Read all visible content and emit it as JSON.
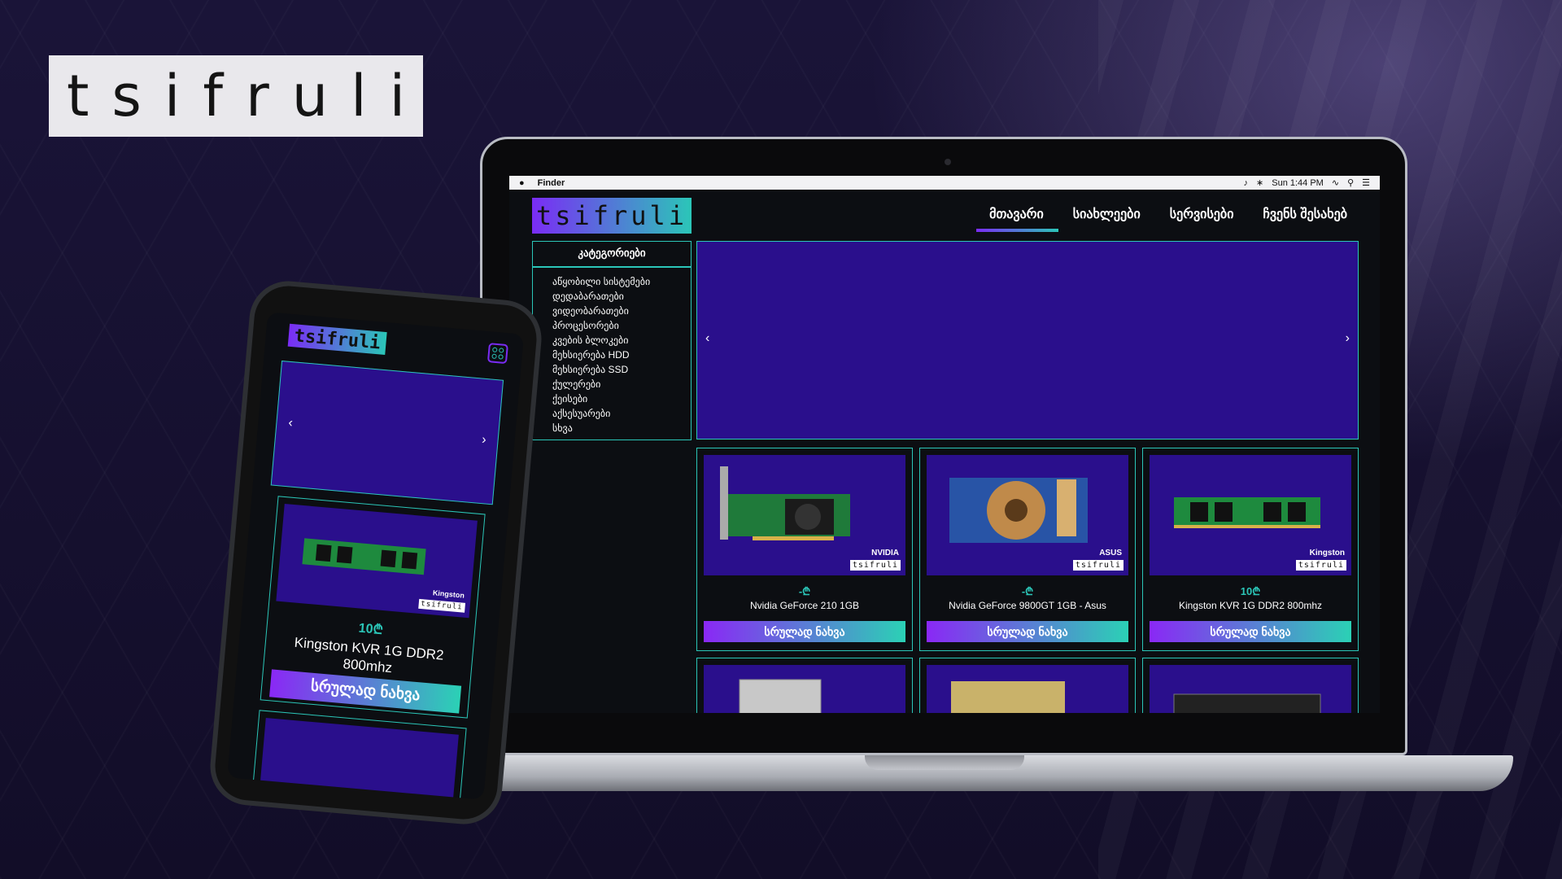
{
  "brand": {
    "text": "tsifruli"
  },
  "macos_menubar": {
    "app": "Finder",
    "clock": "Sun 1:44 PM",
    "icons": [
      "apple-icon",
      "volume-icon",
      "bluetooth-icon",
      "wifi-icon",
      "search-icon",
      "list-icon"
    ]
  },
  "site": {
    "logo": "tsifruli",
    "nav": [
      {
        "label": "მთავარი",
        "active": true
      },
      {
        "label": "სიახლეები",
        "active": false
      },
      {
        "label": "სერვისები",
        "active": false
      },
      {
        "label": "ჩვენს შესახებ",
        "active": false
      }
    ],
    "categories": {
      "title": "კატეგორიები",
      "items": [
        "აწყობილი სისტემები",
        "დედაბარათები",
        "ვიდეობარათები",
        "პროცესორები",
        "კვების ბლოკები",
        "მეხსიერება HDD",
        "მეხსიერება SSD",
        "ქულერები",
        "ქეისები",
        "აქსესუარები",
        "სხვა"
      ]
    },
    "slider": {
      "prev": "‹",
      "next": "›"
    },
    "products": [
      {
        "price": "-₾",
        "name": "Nvidia GeForce 210 1GB",
        "button": "სრულად ნახვა",
        "badge": "tsifruli",
        "brand_mark": "NVIDIA"
      },
      {
        "price": "-₾",
        "name": "Nvidia GeForce 9800GT 1GB - Asus",
        "button": "სრულად ნახვა",
        "badge": "tsifruli",
        "brand_mark": "ASUS"
      },
      {
        "price": "10₾",
        "name": "Kingston KVR 1G DDR2 800mhz",
        "button": "სრულად ნახვა",
        "badge": "tsifruli",
        "brand_mark": "Kingston"
      }
    ]
  },
  "mobile": {
    "logo": "tsifruli",
    "slider": {
      "prev": "‹",
      "next": "›"
    },
    "product": {
      "price": "10₾",
      "name": "Kingston KVR 1G DDR2 800mhz",
      "button": "სრულად ნახვა",
      "badge": "tsifruli",
      "brand_mark": "Kingston"
    }
  },
  "colors": {
    "accent_purple": "#7a2cf5",
    "accent_teal": "#2bc6b8",
    "banner": "#2a0f8c",
    "bg": "#15102e"
  }
}
